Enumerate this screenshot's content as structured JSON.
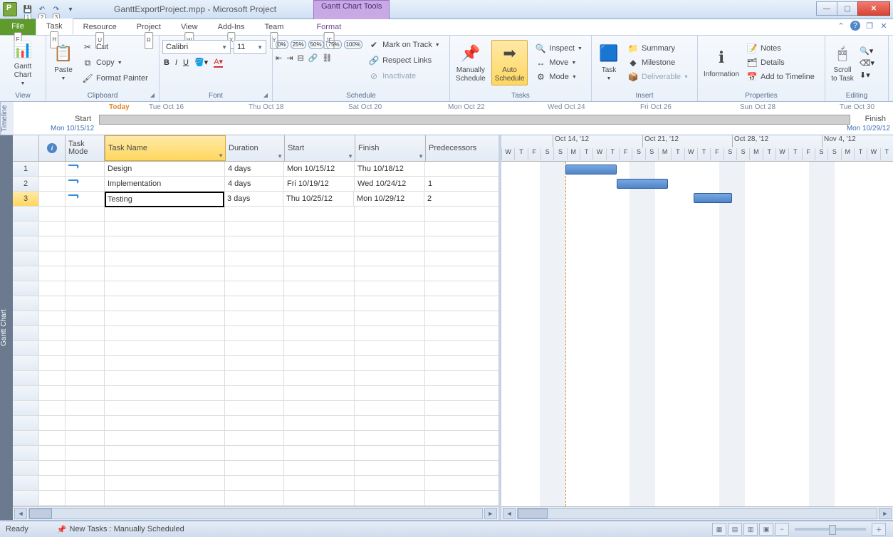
{
  "title": "GanttExportProject.mpp - Microsoft Project",
  "context_tab": "Gantt Chart Tools",
  "qat_nums": [
    "1",
    "2",
    "3"
  ],
  "tabs": {
    "file": "File",
    "task": "Task",
    "resource": "Resource",
    "project": "Project",
    "view": "View",
    "addins": "Add-Ins",
    "team": "Team",
    "format": "Format",
    "k_file": "F",
    "k_task": "H",
    "k_resource": "U",
    "k_project": "R",
    "k_view": "W",
    "k_addins": "X",
    "k_team": "Y",
    "k_format": "JF"
  },
  "ribbon": {
    "view": {
      "gantt": "Gantt\nChart",
      "label": "View"
    },
    "clipboard": {
      "paste": "Paste",
      "cut": "Cut",
      "copy": "Copy",
      "fp": "Format Painter",
      "label": "Clipboard"
    },
    "font": {
      "name": "Calibri",
      "size": "11",
      "label": "Font"
    },
    "schedule": {
      "pct": [
        "0%",
        "25%",
        "50%",
        "75%",
        "100%"
      ],
      "mark": "Mark on Track",
      "respect": "Respect Links",
      "inact": "Inactivate",
      "label": "Schedule"
    },
    "tasks": {
      "man": "Manually\nSchedule",
      "auto": "Auto\nSchedule",
      "inspect": "Inspect",
      "move": "Move",
      "mode": "Mode",
      "label": "Tasks"
    },
    "insert": {
      "task": "Task",
      "summary": "Summary",
      "milestone": "Milestone",
      "deliv": "Deliverable",
      "label": "Insert"
    },
    "props": {
      "info": "Information",
      "notes": "Notes",
      "details": "Details",
      "addtl": "Add to Timeline",
      "label": "Properties"
    },
    "editing": {
      "scroll": "Scroll\nto Task",
      "label": "Editing"
    }
  },
  "timeline": {
    "vtab": "Timeline",
    "today": "Today",
    "start": "Start",
    "finish": "Finish",
    "sdate": "Mon 10/15/12",
    "fdate": "Mon 10/29/12",
    "dates": [
      "Tue Oct 16",
      "Thu Oct 18",
      "Sat Oct 20",
      "Mon Oct 22",
      "Wed Oct 24",
      "Fri Oct 26",
      "Sun Oct 28",
      "Tue Oct 30"
    ]
  },
  "cols": {
    "info": "",
    "mode": "Task\nMode",
    "name": "Task Name",
    "dur": "Duration",
    "start": "Start",
    "finish": "Finish",
    "pred": "Predecessors"
  },
  "rows": [
    {
      "n": "1",
      "name": "Design",
      "dur": "4 days",
      "start": "Mon 10/15/12",
      "finish": "Thu 10/18/12",
      "pred": ""
    },
    {
      "n": "2",
      "name": "Implementation",
      "dur": "4 days",
      "start": "Fri 10/19/12",
      "finish": "Wed 10/24/12",
      "pred": "1"
    },
    {
      "n": "3",
      "name": "Testing",
      "dur": "3 days",
      "start": "Thu 10/25/12",
      "finish": "Mon 10/29/12",
      "pred": "2"
    }
  ],
  "chartlabel": "Gantt Chart",
  "weeks": [
    "Oct 14, '12",
    "Oct 21, '12",
    "Oct 28, '12",
    "Nov 4, '12"
  ],
  "daylabels": [
    "W",
    "T",
    "F",
    "S",
    "S",
    "M",
    "T",
    "W",
    "T",
    "F",
    "S",
    "S",
    "M",
    "T",
    "W",
    "T",
    "F",
    "S",
    "S",
    "M",
    "T",
    "W",
    "T",
    "F",
    "S",
    "S",
    "M",
    "T",
    "W",
    "T"
  ],
  "status": {
    "ready": "Ready",
    "newtasks": "New Tasks : Manually Scheduled"
  },
  "chart_data": {
    "type": "gantt",
    "tasks": [
      {
        "id": 1,
        "name": "Design",
        "start": "2012-10-15",
        "finish": "2012-10-18",
        "duration_days": 4,
        "predecessors": []
      },
      {
        "id": 2,
        "name": "Implementation",
        "start": "2012-10-19",
        "finish": "2012-10-24",
        "duration_days": 4,
        "predecessors": [
          1
        ]
      },
      {
        "id": 3,
        "name": "Testing",
        "start": "2012-10-25",
        "finish": "2012-10-29",
        "duration_days": 3,
        "predecessors": [
          2
        ]
      }
    ],
    "timescale": {
      "start": "2012-10-10",
      "end": "2012-11-10",
      "major_unit": "week",
      "minor_unit": "day"
    }
  }
}
